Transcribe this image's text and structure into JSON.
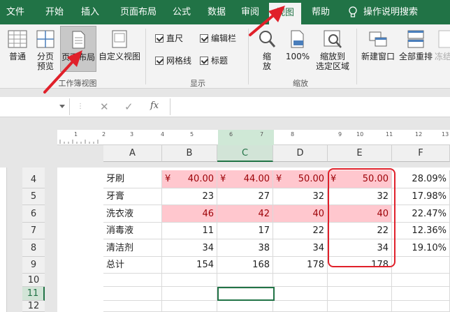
{
  "ribbon_tabs": [
    "文件",
    "开始",
    "插入",
    "页面布局",
    "公式",
    "数据",
    "审阅",
    "视图",
    "帮助",
    "操作说明搜索"
  ],
  "active_tab": "视图",
  "workbook_views": {
    "normal": "普通",
    "page_break_line1": "分页",
    "page_break_line2": "预览",
    "page_layout": "页面布局",
    "custom_views": "自定义视图",
    "group_label": "工作簿视图"
  },
  "show": {
    "ruler": "直尺",
    "formula_bar": "编辑栏",
    "gridlines": "网格线",
    "headings": "标题",
    "group_label": "显示"
  },
  "zoom": {
    "zoom": "缩放",
    "zoom_line1": "缩",
    "zoom_line2": "放",
    "hundred": "100%",
    "to_selection_line1": "缩放到",
    "to_selection_line2": "选定区域",
    "group_label": "缩放"
  },
  "window": {
    "new_window": "新建窗口",
    "arrange_all": "全部重排",
    "freeze": "冻结"
  },
  "formula_bar": {
    "cancel": "✕",
    "enter": "✓",
    "fx": "fx"
  },
  "ruler_numbers": [
    "1",
    "2",
    "3",
    "4",
    "5",
    "6",
    "7",
    "8",
    "9",
    "10",
    "11",
    "12",
    "13"
  ],
  "columns": [
    "A",
    "B",
    "C",
    "D",
    "E",
    "F"
  ],
  "selected_column": "C",
  "rows": [
    "4",
    "5",
    "6",
    "7",
    "8",
    "9",
    "10",
    "11",
    "12"
  ],
  "selected_row": "11",
  "table": [
    {
      "name": "牙刷",
      "b": "40.00",
      "c": "44.00",
      "d": "50.00",
      "e": "50.00",
      "f": "28.09%",
      "currency": "¥",
      "highlight": true
    },
    {
      "name": "牙膏",
      "b": "23",
      "c": "27",
      "d": "32",
      "e": "32",
      "f": "17.98%",
      "highlight": false
    },
    {
      "name": "洗衣液",
      "b": "46",
      "c": "42",
      "d": "40",
      "e": "40",
      "f": "22.47%",
      "highlight": true
    },
    {
      "name": "消毒液",
      "b": "11",
      "c": "17",
      "d": "22",
      "e": "22",
      "f": "12.36%",
      "highlight": false
    },
    {
      "name": "清洁剂",
      "b": "34",
      "c": "38",
      "d": "34",
      "e": "34",
      "f": "19.10%",
      "highlight": false
    },
    {
      "name": "总计",
      "b": "154",
      "c": "168",
      "d": "178",
      "e": "178",
      "f": "",
      "highlight": false
    }
  ],
  "colors": {
    "excel_green": "#217346",
    "highlight_fill": "#ffc7ce",
    "highlight_text": "#9c0006",
    "annotation_red": "#e0202a"
  }
}
